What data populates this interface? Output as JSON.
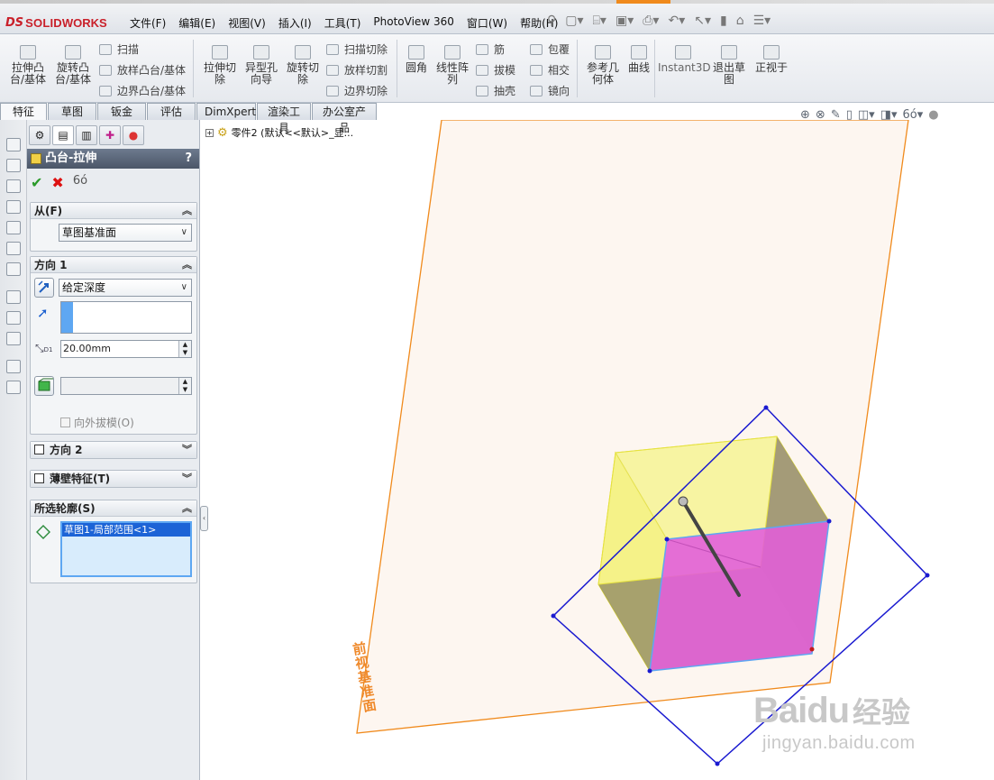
{
  "app": {
    "logo_prefix": "DS",
    "logo_solid": "SOLID",
    "logo_works": "WORKS"
  },
  "menus": [
    "文件(F)",
    "编辑(E)",
    "视图(V)",
    "插入(I)",
    "工具(T)",
    "PhotoView 360",
    "窗口(W)",
    "帮助(H)"
  ],
  "ribbon": {
    "extrude_boss": "拉伸凸台/基体",
    "revolve_boss": "旋转凸台/基体",
    "sweep": "扫描",
    "loft_boss": "放样凸台/基体",
    "boundary_boss": "边界凸台/基体",
    "extrude_cut": "拉伸切除",
    "hole_wizard": "异型孔向导",
    "revolve_cut": "旋转切除",
    "sweep_cut": "扫描切除",
    "loft_cut": "放样切割",
    "boundary_cut": "边界切除",
    "fillet": "圆角",
    "linear_pattern": "线性阵列",
    "rib": "筋",
    "draft": "拔模",
    "shell": "抽壳",
    "wrap": "包覆",
    "intersect": "相交",
    "mirror": "镜向",
    "ref_geometry": "参考几何体",
    "curves": "曲线",
    "instant3d": "Instant3D",
    "exit_sketch": "退出草图",
    "normal_to": "正视于"
  },
  "cmd_tabs": [
    "特征",
    "草图",
    "钣金",
    "评估",
    "DimXpert",
    "渲染工具",
    "办公室产品"
  ],
  "tree": {
    "part_label": "零件2 (默认<<默认>_显..."
  },
  "pm": {
    "title": "凸台-拉伸",
    "help": "?",
    "ok": "✔",
    "cancel": "✖",
    "from_label": "从(F)",
    "from_value": "草图基准面",
    "dir1_label": "方向 1",
    "end_condition": "给定深度",
    "depth": "20.00mm",
    "draft_outward": "向外拔模(O)",
    "dir2_label": "方向 2",
    "thin_label": "薄壁特征(T)",
    "contours_label": "所选轮廓(S)",
    "contour_item": "草图1-局部范围<1>"
  },
  "graphics": {
    "plane_name": "前视基准面"
  },
  "watermark": {
    "brand": "Bai",
    "brand2": "du",
    "cn": "经验",
    "url": "jingyan.baidu.com"
  },
  "colors": {
    "plane_edge": "#f08a1c",
    "sketch_blue": "#1a1ad0",
    "preview_yellow": "#f5f28a",
    "preview_magenta": "#e35ad6"
  }
}
